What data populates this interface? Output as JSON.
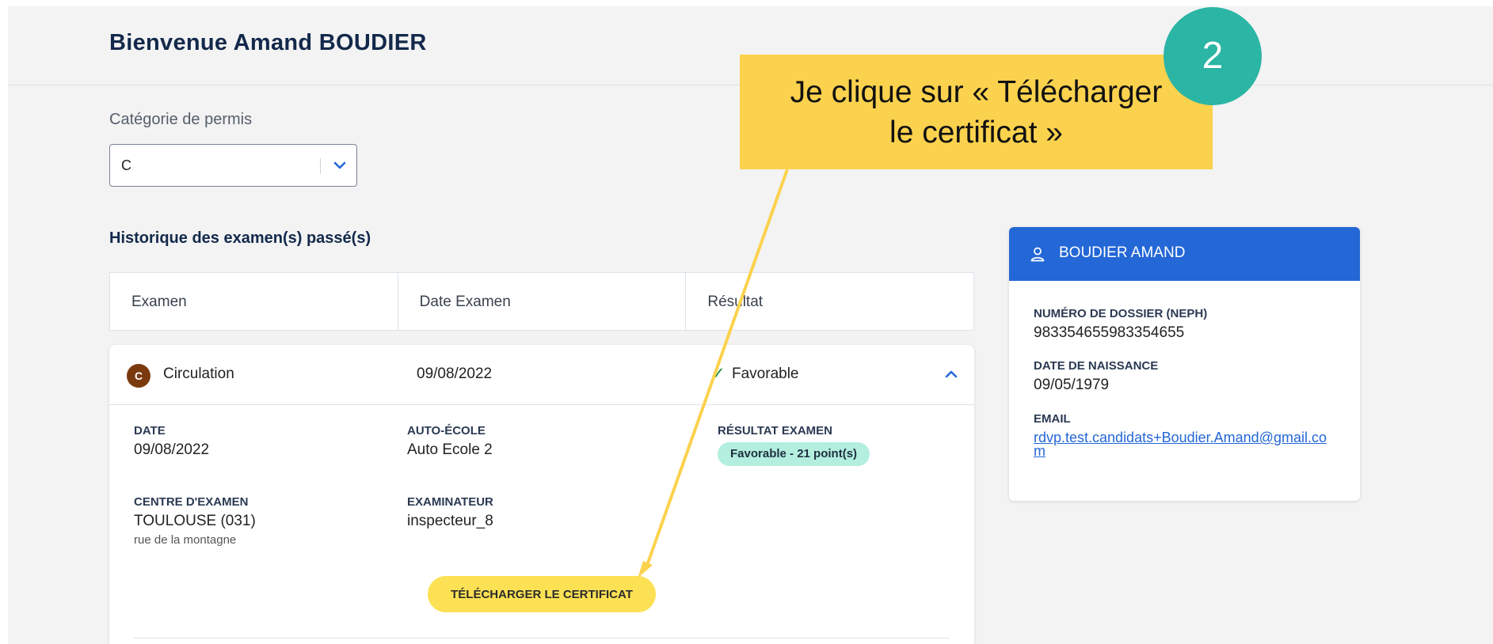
{
  "header": {
    "welcome": "Bienvenue Amand BOUDIER"
  },
  "filter": {
    "label": "Catégorie de permis",
    "selected": "C"
  },
  "history": {
    "title": "Historique des examen(s) passé(s)",
    "columns": [
      "Examen",
      "Date Examen",
      "Résultat"
    ],
    "row": {
      "badge": "C",
      "exam": "Circulation",
      "date": "09/08/2022",
      "result": "Favorable",
      "details": {
        "date_label": "DATE",
        "date_value": "09/08/2022",
        "school_label": "AUTO-ÉCOLE",
        "school_value": "Auto Ecole 2",
        "result_label": "RÉSULTAT EXAMEN",
        "result_pill": "Favorable - 21 point(s)",
        "center_label": "CENTRE D'EXAMEN",
        "center_value": "TOULOUSE (031)",
        "center_address": "rue de la montagne",
        "examiner_label": "EXAMINATEUR",
        "examiner_value": "inspecteur_8",
        "download_button": "TÉLÉCHARGER LE CERTIFICAT"
      }
    }
  },
  "profile": {
    "name": "BOUDIER AMAND",
    "dossier_label": "NUMÉRO DE DOSSIER (NEPH)",
    "dossier_value": "983354655983354655",
    "birth_label": "DATE DE NAISSANCE",
    "birth_value": "09/05/1979",
    "email_label": "EMAIL",
    "email_value": "rdvp.test.candidats+Boudier.Amand@gmail.com"
  },
  "annotation": {
    "step_number": "2",
    "callout_line1": "Je clique sur « Télécharger",
    "callout_line2": "le certificat »"
  },
  "colors": {
    "brand_blue": "#2467d6",
    "callout_yellow": "#fbd24e",
    "step_teal": "#2bb5a5",
    "button_yellow": "#fde154",
    "pill_green": "#b3eedf"
  }
}
